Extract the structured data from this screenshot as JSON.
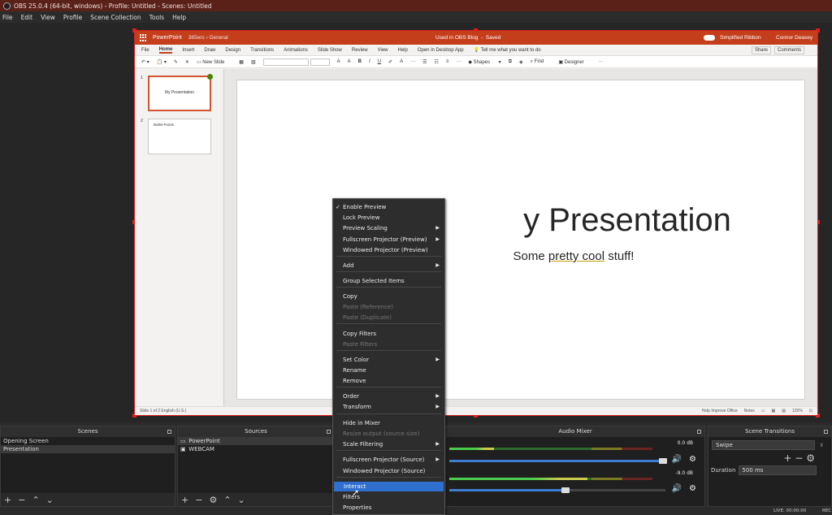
{
  "window": {
    "title": "OBS 25.0.4 (64-bit, windows) - Profile: Untitled - Scenes: Untitled"
  },
  "menu": [
    "File",
    "Edit",
    "View",
    "Profile",
    "Scene Collection",
    "Tools",
    "Help"
  ],
  "ppt": {
    "app_name": "PowerPoint",
    "breadcrumb": "365ers › General",
    "doc_title": "Used in OBS Blog",
    "saved": "Saved",
    "simplified_ribbon": "Simplified Ribbon",
    "user": "Connor Deasey",
    "tabs": [
      "File",
      "Home",
      "Insert",
      "Draw",
      "Design",
      "Transitions",
      "Animations",
      "Slide Show",
      "Review",
      "View",
      "Help",
      "Open in Desktop App",
      "Tell me what you want to do"
    ],
    "share": "Share",
    "comments": "Comments",
    "tools": {
      "new_slide": "New Slide",
      "shapes": "Shapes",
      "find": "Find",
      "designer": "Designer"
    },
    "thumbs": [
      {
        "num": "1",
        "title": "My Presentation"
      },
      {
        "num": "2",
        "title": "Bullet Points"
      }
    ],
    "slide_title_tail": "y Presentation",
    "slide_sub_pre": "Some",
    "slide_sub_u": "pretty cool",
    "slide_sub_post": "stuff!",
    "status_left": "Slide 1 of 2    English (U.S.)",
    "status_help": "Help Improve Office",
    "status_notes": "Notes",
    "status_zoom": "125%"
  },
  "scenes": {
    "header": "Scenes",
    "items": [
      "Opening Screen",
      "Presentation"
    ]
  },
  "sources": {
    "header": "Sources",
    "items": [
      {
        "name": "PowerPoint",
        "icon": "monitor-icon"
      },
      {
        "name": "WEBCAM",
        "icon": "camera-icon"
      }
    ]
  },
  "mixer": {
    "header": "Audio Mixer",
    "db1": "0.0 dB",
    "db2": "-9.0 dB",
    "level1": 0.22,
    "level2": 0.68
  },
  "transitions": {
    "header": "Scene Transitions",
    "type": "Swipe",
    "duration_label": "Duration",
    "duration": "500 ms"
  },
  "statusbar": {
    "live": "LIVE: 00:00:00",
    "rec": "REC"
  },
  "context_menu": {
    "items": [
      {
        "label": "Enable Preview",
        "check": true
      },
      {
        "label": "Lock Preview"
      },
      {
        "label": "Preview Scaling",
        "sub": true
      },
      {
        "label": "Fullscreen Projector (Preview)",
        "sub": true
      },
      {
        "label": "Windowed Projector (Preview)"
      },
      {
        "label": "Add",
        "sub": true
      },
      {
        "label": "Group Selected Items"
      },
      {
        "label": "Copy"
      },
      {
        "label": "Paste (Reference)",
        "disabled": true
      },
      {
        "label": "Paste (Duplicate)",
        "disabled": true
      },
      {
        "label": "Copy Filters"
      },
      {
        "label": "Paste Filters",
        "disabled": true
      },
      {
        "label": "Set Color",
        "sub": true
      },
      {
        "label": "Rename"
      },
      {
        "label": "Remove"
      },
      {
        "label": "Order",
        "sub": true
      },
      {
        "label": "Transform",
        "sub": true
      },
      {
        "label": "Hide in Mixer"
      },
      {
        "label": "Resize output (source size)",
        "disabled": true
      },
      {
        "label": "Scale Filtering",
        "sub": true
      },
      {
        "label": "Fullscreen Projector (Source)",
        "sub": true
      },
      {
        "label": "Windowed Projector (Source)"
      },
      {
        "label": "Interact",
        "highlighted": true
      },
      {
        "label": "Filters"
      },
      {
        "label": "Properties"
      }
    ]
  }
}
